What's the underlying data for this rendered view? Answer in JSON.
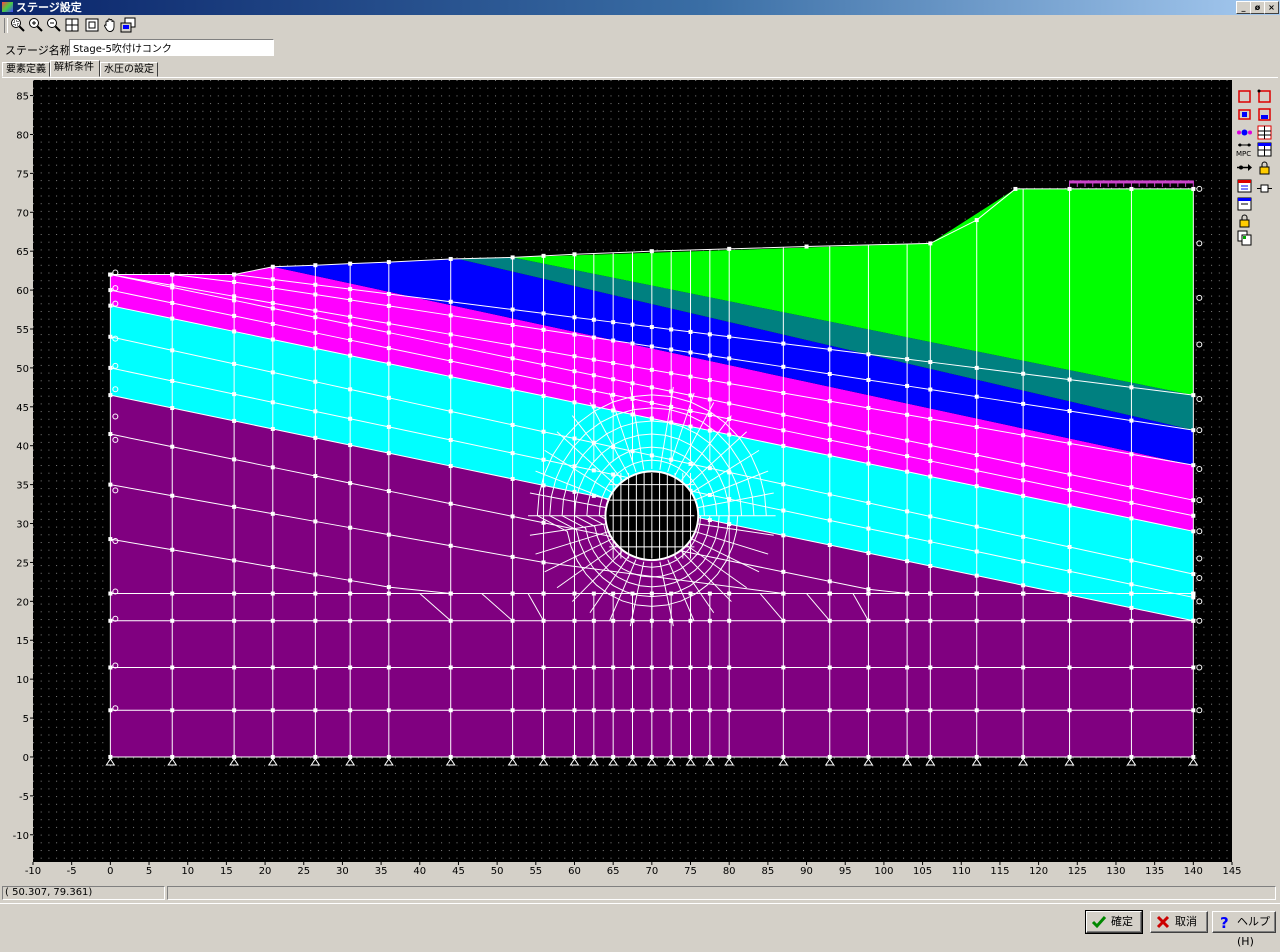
{
  "window": {
    "title": "ステージ設定",
    "controls": [
      "_",
      "ø",
      "×"
    ]
  },
  "toolbar": {
    "buttons": [
      "zoom-window-icon",
      "zoom-in-icon",
      "zoom-out-icon",
      "zoom-all-icon",
      "fit-icon",
      "pan-hand-icon",
      "redraw-icon"
    ]
  },
  "stage": {
    "label": "ステージ名称",
    "value": "Stage-5吹付けコンク"
  },
  "tabs": [
    {
      "label": "要素定義"
    },
    {
      "label": "解析条件",
      "active": true
    },
    {
      "label": "水圧の設定"
    }
  ],
  "side_toolbar": {
    "labels": [
      "MPC"
    ]
  },
  "status": {
    "coords": "( 50.307,  79.361)"
  },
  "buttons": {
    "ok": "確定",
    "cancel": "取消",
    "help": "ヘルプ(H)"
  },
  "colors": {
    "background": "#000000",
    "mesh": "#ffffff",
    "layer_purple": "#800080",
    "layer_cyan": "#00ffff",
    "layer_magenta": "#ff00ff",
    "layer_blue": "#0000ff",
    "layer_teal": "#008080",
    "layer_green": "#00ff00",
    "tunnel": "#000000",
    "load": "#cc44cc"
  },
  "chart_data": {
    "type": "diagram",
    "title": "",
    "xlabel": "",
    "ylabel": "",
    "xlim": [
      -10,
      145
    ],
    "ylim": [
      -13.5,
      87
    ],
    "x_ticks": [
      -10,
      -5,
      0,
      5,
      10,
      15,
      20,
      25,
      30,
      35,
      40,
      45,
      50,
      55,
      60,
      65,
      70,
      75,
      80,
      85,
      90,
      95,
      100,
      105,
      110,
      115,
      120,
      125,
      130,
      135,
      140,
      145
    ],
    "y_ticks": [
      -10,
      -5,
      0,
      5,
      10,
      15,
      20,
      25,
      30,
      35,
      40,
      45,
      50,
      55,
      60,
      65,
      70,
      75,
      80,
      85
    ],
    "grid": true,
    "layers": [
      {
        "name": "",
        "color": "#800080",
        "polygon": [
          [
            0,
            0
          ],
          [
            140,
            0
          ],
          [
            140,
            17.5
          ],
          [
            0,
            46.5
          ]
        ]
      },
      {
        "name": "",
        "color": "#00ffff",
        "polygon": [
          [
            0,
            46.5
          ],
          [
            140,
            17.5
          ],
          [
            140,
            29
          ],
          [
            0,
            58
          ]
        ]
      },
      {
        "name": "",
        "color": "#ff00ff",
        "polygon": [
          [
            0,
            58
          ],
          [
            140,
            29
          ],
          [
            140,
            37.5
          ],
          [
            21,
            63
          ],
          [
            16,
            62
          ],
          [
            0,
            62
          ]
        ]
      },
      {
        "name": "",
        "color": "#0000ff",
        "polygon": [
          [
            21,
            63
          ],
          [
            140,
            37.5
          ],
          [
            140,
            42
          ],
          [
            45,
            64
          ]
        ]
      },
      {
        "name": "",
        "color": "#008080",
        "polygon": [
          [
            45,
            64
          ],
          [
            140,
            42
          ],
          [
            140,
            46.5
          ],
          [
            52,
            64.2
          ]
        ]
      },
      {
        "name": "",
        "color": "#00ff00",
        "polygon": [
          [
            52,
            64.2
          ],
          [
            140,
            46.5
          ],
          [
            140,
            73
          ],
          [
            119,
            73
          ],
          [
            117,
            73
          ],
          [
            106,
            66
          ]
        ]
      }
    ],
    "tunnel": {
      "center": [
        70,
        31
      ],
      "radius": 6
    },
    "mesh_x": [
      0,
      8,
      16,
      21,
      26.5,
      31,
      36,
      44,
      52,
      56,
      60,
      62.5,
      65,
      67.5,
      70,
      72.5,
      75,
      77.5,
      80,
      87,
      93,
      98,
      103,
      106,
      112,
      118,
      124,
      132,
      140
    ],
    "mesh_y_bottom": [
      0,
      6,
      11.5,
      17.5,
      21
    ],
    "supports_x": [
      0,
      8,
      16,
      21,
      26.5,
      31,
      36,
      44,
      52,
      56,
      60,
      62.5,
      65,
      67.5,
      70,
      72.5,
      75,
      77.5,
      80,
      87,
      93,
      98,
      103,
      106,
      112,
      118,
      124,
      132,
      140
    ],
    "load": {
      "x_from": 124,
      "x_to": 140,
      "y": 73
    }
  }
}
